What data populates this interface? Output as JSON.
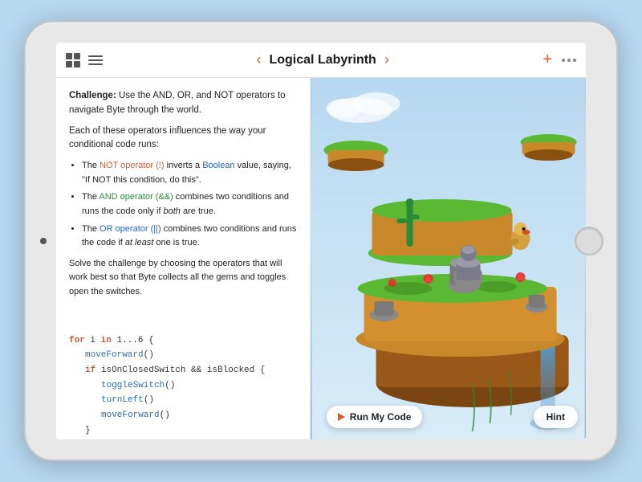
{
  "ipad": {
    "nav": {
      "title": "Logical Labyrinth",
      "back_arrow": "‹",
      "forward_arrow": "›",
      "plus_label": "+",
      "grid_icon": "grid-icon",
      "list_icon": "list-icon"
    },
    "left_panel": {
      "challenge_label": "Challenge:",
      "challenge_text": "Use the AND, OR, and NOT operators to navigate Byte through the world.",
      "intro_text": "Each of these operators influences the way your conditional code runs:",
      "bullets": [
        {
          "prefix": "The ",
          "highlight1": "NOT operator (!)",
          "highlight1_color": "red",
          "middle1": " inverts a ",
          "highlight2": "Boolean",
          "highlight2_color": "blue",
          "suffix1": " value, saying, \"If NOT this condition, do this\"."
        },
        {
          "prefix": "The ",
          "highlight1": "AND operator (&&)",
          "highlight1_color": "green",
          "middle1": " combines two conditions and runs the code only if ",
          "italic": "both",
          "suffix1": " are true."
        },
        {
          "prefix": "The ",
          "highlight1": "OR operator (||)",
          "highlight1_color": "blue",
          "middle1": " combines two conditions and runs the code if ",
          "italic": "at least",
          "suffix1": " one is true."
        }
      ],
      "solve_text": "Solve the challenge by choosing the operators that will work best so that Byte collects all the gems and toggles open the switches.",
      "code": {
        "line1": "for i in 1...6 {",
        "line2": "    moveForward()",
        "line3": "    if isOnClosedSwitch && isBlocked {",
        "line4": "        toggleSwitch()",
        "line5": "        turnLeft()",
        "line6": "        moveForward()",
        "line7": "    }"
      }
    },
    "right_panel": {
      "run_button_label": "Run My Code",
      "hint_button_label": "Hint"
    }
  }
}
